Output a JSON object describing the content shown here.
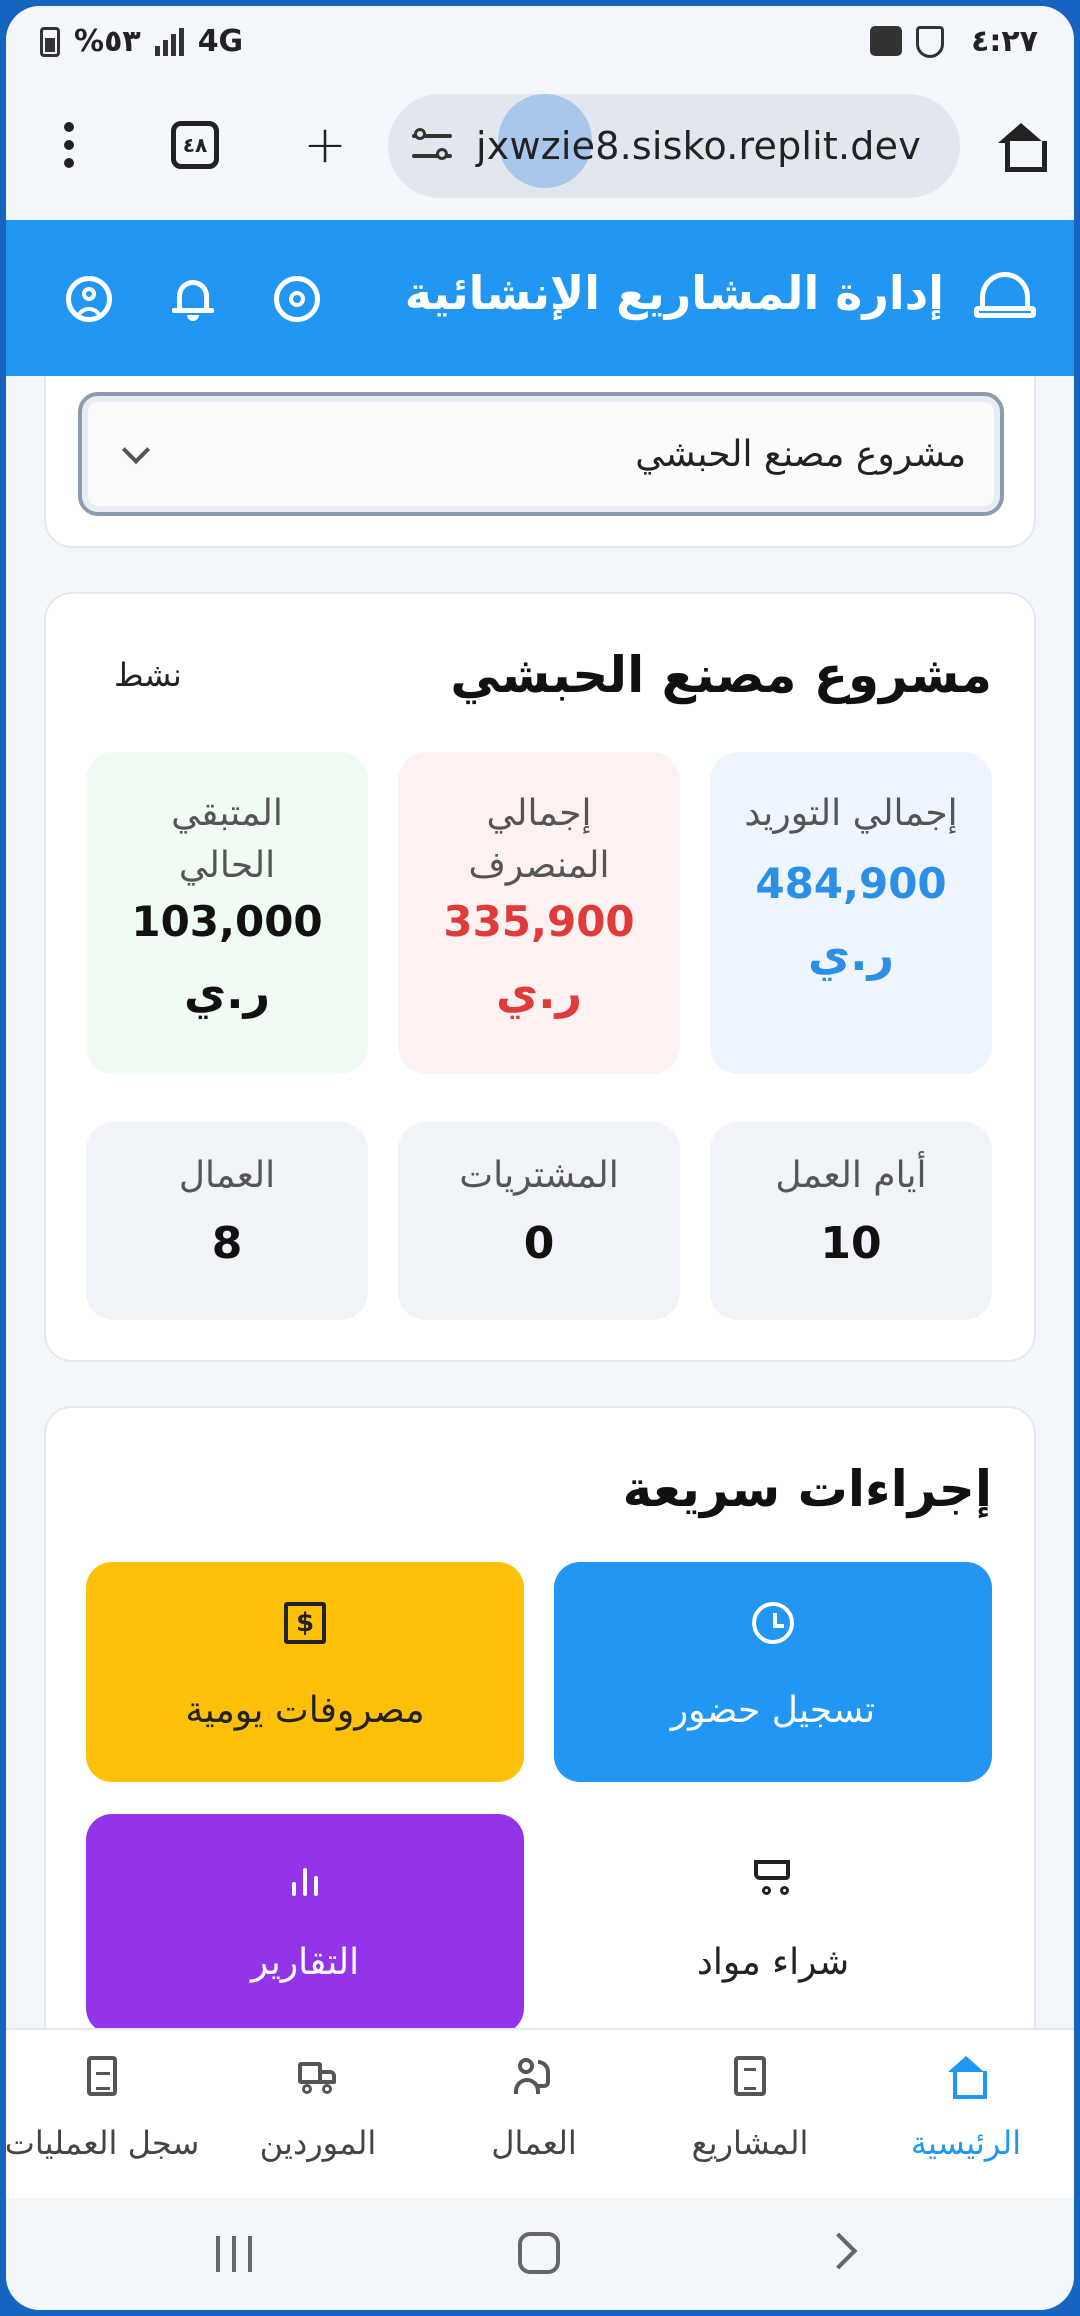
{
  "status_bar": {
    "time": "٤:٢٧",
    "battery": "%٥٣",
    "network": "4G"
  },
  "browser": {
    "url": "jxwzie8.sisko.replit.dev",
    "tab_count": "٤٨",
    "new_tab": "+"
  },
  "header": {
    "title": "إدارة المشاريع الإنشائية"
  },
  "project_selector": {
    "selected": "مشروع مصنع الحبشي"
  },
  "project": {
    "name": "مشروع مصنع الحبشي",
    "status": "نشط",
    "stats": [
      {
        "label": "إجمالي التوريد",
        "value": "484,900",
        "currency": "ر.ي"
      },
      {
        "label": "إجمالي المنصرف",
        "value": "335,900",
        "currency": "ر.ي"
      },
      {
        "label": "المتبقي الحالي",
        "value": "103,000",
        "currency": "ر.ي"
      }
    ],
    "counts": [
      {
        "label": "أيام العمل",
        "value": "10"
      },
      {
        "label": "المشتريات",
        "value": "0"
      },
      {
        "label": "العمال",
        "value": "8"
      }
    ]
  },
  "quick_actions": {
    "title": "إجراءات سريعة",
    "items": [
      {
        "label": "تسجيل حضور",
        "icon": "clock-icon",
        "color": "#2196f3"
      },
      {
        "label": "مصروفات يومية",
        "icon": "receipt-icon",
        "color": "#fec107"
      },
      {
        "label": "شراء مواد",
        "icon": "cart-icon",
        "color": "#ffffff"
      },
      {
        "label": "التقارير",
        "icon": "bar-chart-icon",
        "color": "#9334ea"
      }
    ]
  },
  "bottom_nav": {
    "items": [
      {
        "label": "الرئيسية",
        "icon": "home-icon",
        "active": true
      },
      {
        "label": "المشاريع",
        "icon": "building-icon"
      },
      {
        "label": "العمال",
        "icon": "users-icon"
      },
      {
        "label": "الموردين",
        "icon": "truck-icon"
      },
      {
        "label": "سجل العمليات",
        "icon": "file-icon"
      }
    ]
  },
  "colors": {
    "primary": "#2196f3",
    "supply": "#2b8fe6",
    "spent": "#e03b3b",
    "reports": "#9334ea",
    "expenses": "#fec107"
  }
}
